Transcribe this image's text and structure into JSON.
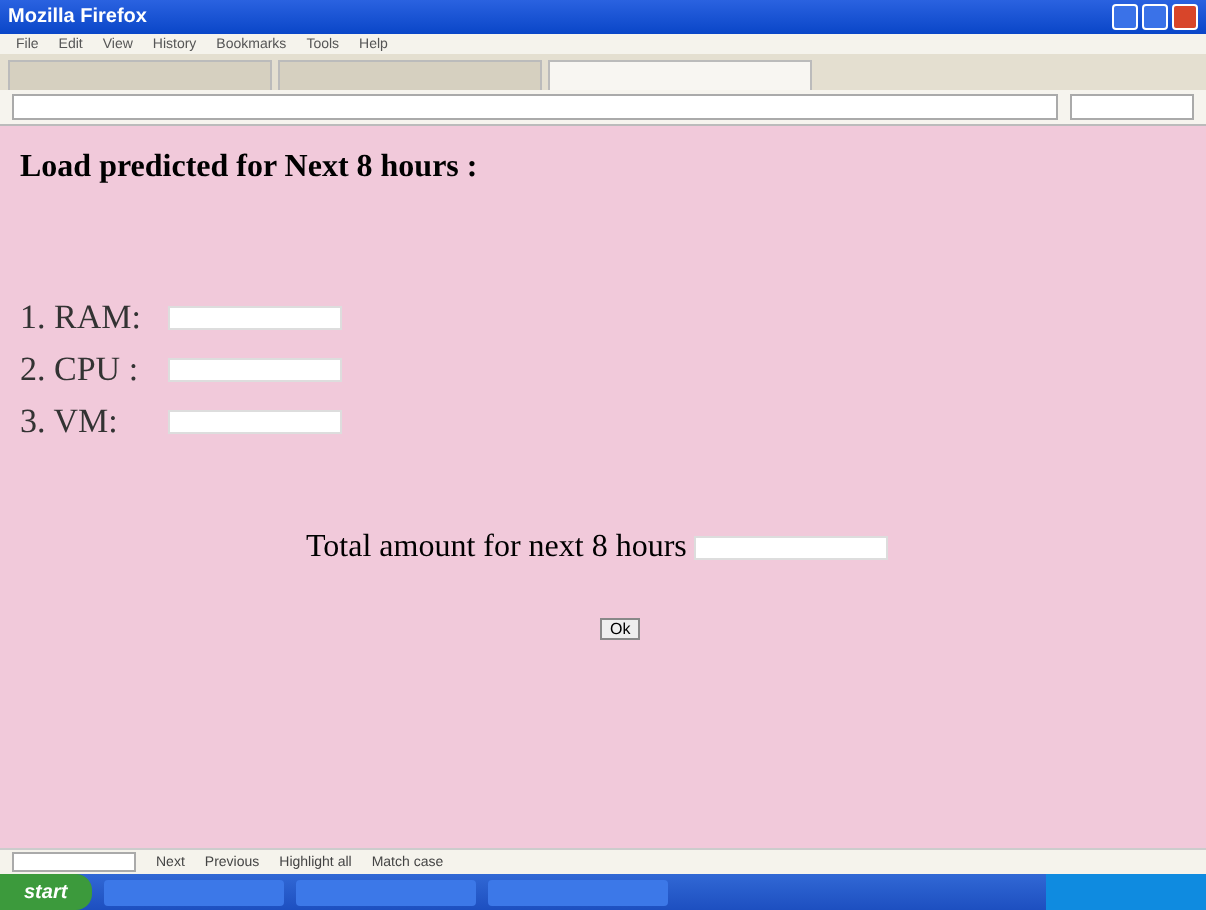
{
  "window": {
    "title": "Mozilla Firefox"
  },
  "menu": [
    "File",
    "Edit",
    "View",
    "History",
    "Bookmarks",
    "Tools",
    "Help"
  ],
  "tabs": [
    {
      "selected": false
    },
    {
      "selected": false
    },
    {
      "selected": true
    }
  ],
  "page": {
    "heading": "Load predicted for Next 8 hours :",
    "fields": [
      {
        "label": "1. RAM:"
      },
      {
        "label": "2. CPU :"
      },
      {
        "label": "3. VM:"
      }
    ],
    "total": {
      "label": "Total amount for next 8 hours"
    },
    "button": "Ok"
  },
  "find_bar": {
    "items": [
      "Next",
      "Previous",
      "Highlight all",
      "Match case"
    ]
  },
  "taskbar": {
    "start": "start"
  }
}
